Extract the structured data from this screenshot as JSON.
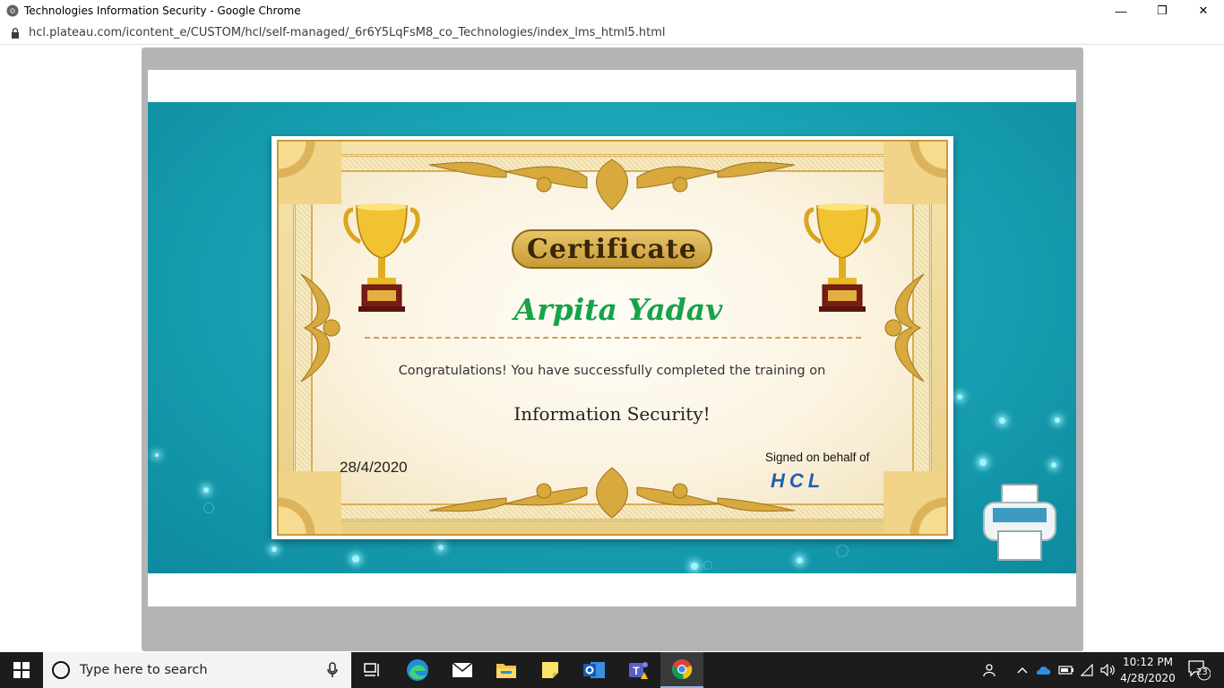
{
  "window": {
    "title": "Technologies Information Security - Google Chrome",
    "minimize_glyph": "—",
    "restore_glyph": "❐",
    "close_glyph": "✕"
  },
  "addressbar": {
    "url": "hcl.plateau.com/icontent_e/CUSTOM/hcl/self-managed/_6r6Y5LqFsM8_co_Technologies/index_lms_html5.html"
  },
  "certificate": {
    "title": "Certificate",
    "recipient": "Arpita Yadav",
    "message": "Congratulations! You have successfully completed the training on",
    "course": "Information Security!",
    "date": "28/4/2020",
    "signed_label": "Signed on behalf of",
    "company": "HCL",
    "colors": {
      "recipient": "#17a34a",
      "company": "#1f5fb6",
      "background": "#1aa4b6"
    }
  },
  "taskbar": {
    "search_placeholder": "Type here to search",
    "time": "10:12 PM",
    "date": "4/28/2020",
    "notifications": "23",
    "apps": [
      "task-view-icon",
      "edge-icon",
      "mail-icon",
      "file-explorer-icon",
      "sticky-notes-icon",
      "outlook-icon",
      "teams-icon",
      "chrome-icon"
    ]
  }
}
